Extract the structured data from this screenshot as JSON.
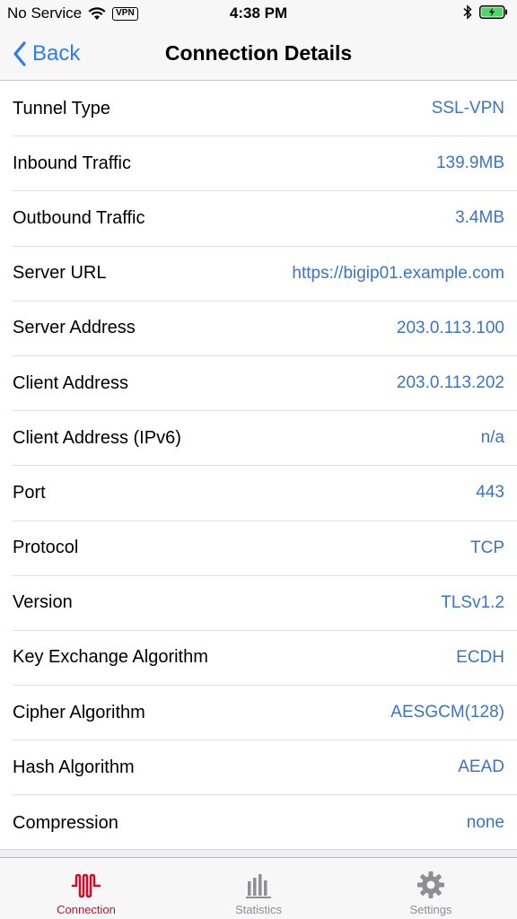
{
  "status_bar": {
    "carrier": "No Service",
    "vpn_badge": "VPN",
    "time": "4:38 PM",
    "wifi_icon": "wifi-icon",
    "bluetooth_icon": "bluetooth-icon",
    "battery_icon": "battery-charging-icon"
  },
  "nav": {
    "back_label": "Back",
    "title": "Connection Details"
  },
  "details": [
    {
      "label": "Tunnel Type",
      "value": "SSL-VPN"
    },
    {
      "label": "Inbound Traffic",
      "value": "139.9MB"
    },
    {
      "label": "Outbound Traffic",
      "value": "3.4MB"
    },
    {
      "label": "Server URL",
      "value": "https://bigip01.example.com"
    },
    {
      "label": "Server Address",
      "value": "203.0.113.100"
    },
    {
      "label": "Client Address",
      "value": "203.0.113.202"
    },
    {
      "label": "Client Address (IPv6)",
      "value": "n/a"
    },
    {
      "label": "Port",
      "value": "443"
    },
    {
      "label": "Protocol",
      "value": "TCP"
    },
    {
      "label": "Version",
      "value": "TLSv1.2"
    },
    {
      "label": "Key Exchange Algorithm",
      "value": "ECDH"
    },
    {
      "label": "Cipher Algorithm",
      "value": "AESGCM(128)"
    },
    {
      "label": "Hash Algorithm",
      "value": "AEAD"
    },
    {
      "label": "Compression",
      "value": "none"
    }
  ],
  "tabs": [
    {
      "label": "Connection",
      "icon": "connection-waveform-icon",
      "active": true
    },
    {
      "label": "Statistics",
      "icon": "bar-chart-icon",
      "active": false
    },
    {
      "label": "Settings",
      "icon": "gear-icon",
      "active": false
    }
  ],
  "colors": {
    "accent_blue": "#2f7bf5",
    "value_blue": "#3b74c4",
    "active_tab_red": "#c8102e",
    "inactive_tab_gray": "#8e8e93"
  }
}
